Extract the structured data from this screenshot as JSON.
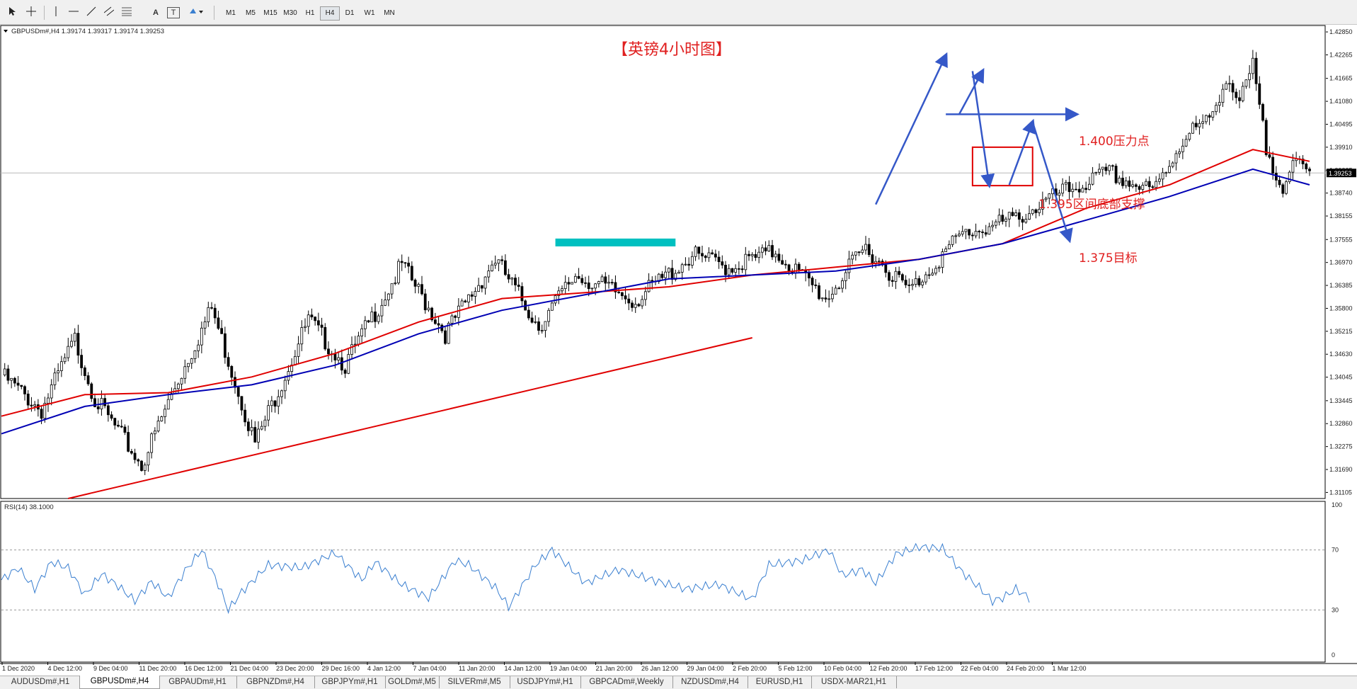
{
  "window": {
    "symbol_header": "GBPUSDm#,H4  1.39174 1.39317 1.39174 1.39253",
    "rsi_header": "RSI(14) 38.1000",
    "current_price_label": "1.39253"
  },
  "toolbar": {
    "tools": [
      "cursor-icon",
      "crosshair-icon",
      "vertical-line-icon",
      "horizontal-line-icon",
      "trendline-icon",
      "channel-icon",
      "fibonacci-icon",
      "text-label-icon",
      "text-box-icon",
      "shapes-icon"
    ],
    "text_tool": "A",
    "textbox_tool": "T",
    "timeframes": [
      "M1",
      "M5",
      "M15",
      "M30",
      "H1",
      "H4",
      "D1",
      "W1",
      "MN"
    ],
    "active_timeframe": "H4"
  },
  "tabs": {
    "items": [
      "AUDUSDm#,H1",
      "GBPUSDm#,H4",
      "GBPAUDm#,H1",
      "GBPNZDm#,H4",
      "GBPJPYm#,H1",
      "GOLDm#,M5",
      "SILVERm#,M5",
      "USDJPYm#,H1",
      "GBPCADm#,Weekly",
      "NZDUSDm#,H4",
      "EURUSD,H1",
      "USDX-MAR21,H1"
    ],
    "active": "GBPUSDm#,H4"
  },
  "chart_data": [
    {
      "type": "candlestick",
      "title": "【英镑4小时图】",
      "ylim": [
        1.3095,
        1.4305
      ],
      "y_ticks": [
        "1.42850",
        "1.42265",
        "1.41665",
        "1.41080",
        "1.40495",
        "1.39910",
        "1.39325",
        "1.38740",
        "1.38155",
        "1.37555",
        "1.36970",
        "1.36385",
        "1.35800",
        "1.35215",
        "1.34630",
        "1.34045",
        "1.33445",
        "1.32860",
        "1.32275",
        "1.31690",
        "1.31105"
      ],
      "x_ticks": [
        "1 Dec 2020",
        "4 Dec 12:00",
        "9 Dec 04:00",
        "11 Dec 20:00",
        "16 Dec 12:00",
        "21 Dec 04:00",
        "23 Dec 20:00",
        "29 Dec 16:00",
        "4 Jan 12:00",
        "7 Jan 04:00",
        "11 Jan 20:00",
        "14 Jan 12:00",
        "19 Jan 04:00",
        "21 Jan 20:00",
        "26 Jan 12:00",
        "29 Jan 04:00",
        "2 Feb 20:00",
        "5 Feb 12:00",
        "10 Feb 04:00",
        "12 Feb 20:00",
        "17 Feb 12:00",
        "22 Feb 04:00",
        "24 Feb 20:00",
        "1 Mar 12:00"
      ],
      "close_path": [
        [
          0,
          1.341
        ],
        [
          12,
          1.332
        ],
        [
          22,
          1.35
        ],
        [
          28,
          1.335
        ],
        [
          42,
          1.318
        ],
        [
          52,
          1.338
        ],
        [
          63,
          1.358
        ],
        [
          76,
          1.3235
        ],
        [
          92,
          1.355
        ],
        [
          103,
          1.3435
        ],
        [
          120,
          1.369
        ],
        [
          133,
          1.3515
        ],
        [
          148,
          1.3705
        ],
        [
          161,
          1.3535
        ],
        [
          172,
          1.3665
        ],
        [
          190,
          1.36
        ],
        [
          207,
          1.3715
        ],
        [
          218,
          1.3685
        ],
        [
          232,
          1.3725
        ],
        [
          247,
          1.3605
        ],
        [
          259,
          1.3735
        ],
        [
          272,
          1.3625
        ],
        [
          288,
          1.377
        ],
        [
          303,
          1.3805
        ],
        [
          318,
          1.3875
        ],
        [
          332,
          1.3925
        ],
        [
          345,
          1.3875
        ],
        [
          355,
          1.4025
        ],
        [
          362,
          1.4055
        ],
        [
          367,
          1.4175
        ],
        [
          371,
          1.41
        ],
        [
          375,
          1.4195
        ],
        [
          379,
          1.3985
        ],
        [
          384,
          1.3895
        ],
        [
          388,
          1.3945
        ],
        [
          392,
          1.3925
        ]
      ],
      "last_price": 1.39253,
      "series": [
        {
          "name": "",
          "color": "#e00000",
          "points": [
            [
              0,
              1.3305
            ],
            [
              25,
              1.336
            ],
            [
              50,
              1.3365
            ],
            [
              75,
              1.3405
            ],
            [
              100,
              1.3465
            ],
            [
              125,
              1.3545
            ],
            [
              150,
              1.3605
            ],
            [
              175,
              1.362
            ],
            [
              200,
              1.3635
            ],
            [
              225,
              1.3665
            ],
            [
              250,
              1.3685
            ],
            [
              275,
              1.3705
            ],
            [
              300,
              1.3745
            ],
            [
              325,
              1.3835
            ],
            [
              350,
              1.3895
            ],
            [
              375,
              1.3985
            ],
            [
              392,
              1.3955
            ]
          ]
        },
        {
          "name": "",
          "color": "#0000b4",
          "points": [
            [
              0,
              1.326
            ],
            [
              25,
              1.333
            ],
            [
              50,
              1.336
            ],
            [
              75,
              1.3385
            ],
            [
              100,
              1.3435
            ],
            [
              125,
              1.3515
            ],
            [
              150,
              1.3575
            ],
            [
              175,
              1.3615
            ],
            [
              200,
              1.3655
            ],
            [
              225,
              1.3665
            ],
            [
              250,
              1.3675
            ],
            [
              275,
              1.3705
            ],
            [
              300,
              1.3745
            ],
            [
              325,
              1.3805
            ],
            [
              350,
              1.3865
            ],
            [
              375,
              1.3935
            ],
            [
              392,
              1.3895
            ]
          ]
        }
      ],
      "annotations": {
        "resistance_label": "1.400压力点",
        "support_label": "1.395区间底部支撑",
        "target_label": "1.375目标",
        "trendline": {
          "color": "#e00000",
          "from": [
            20,
            1.3095
          ],
          "to": [
            225,
            1.3505
          ]
        },
        "resistance_zone": {
          "color": "#00c0c0",
          "x": [
            166,
            202
          ],
          "y": [
            1.3738,
            1.3758
          ]
        },
        "pattern_box": {
          "color": "#e00000",
          "x": [
            291,
            309
          ],
          "y": [
            1.3893,
            1.3991
          ]
        },
        "horizontal_arrow": {
          "x": [
            283,
            322
          ],
          "y": 1.4075
        },
        "up_arrows": [
          [
            [
              262,
              1.3845
            ],
            [
              283,
              1.4225
            ]
          ],
          [
            [
              287,
              1.4075
            ],
            [
              294,
              1.4185
            ]
          ],
          [
            [
              302,
              1.3895
            ],
            [
              309,
              1.4055
            ]
          ]
        ],
        "down_arrows": [
          [
            [
              291,
              1.4185
            ],
            [
              296,
              1.3895
            ]
          ],
          [
            [
              309,
              1.4055
            ],
            [
              320,
              1.3755
            ]
          ]
        ]
      }
    },
    {
      "type": "line",
      "title": "RSI(14) 38.1000",
      "ylim": [
        0,
        100
      ],
      "y_ticks": [
        "100",
        "70",
        "30",
        "0"
      ],
      "levels": [
        70,
        30
      ],
      "color": "#3a7fd0",
      "points": [
        [
          0,
          50
        ],
        [
          5,
          58
        ],
        [
          10,
          44
        ],
        [
          15,
          62
        ],
        [
          20,
          58
        ],
        [
          25,
          40
        ],
        [
          30,
          54
        ],
        [
          35,
          46
        ],
        [
          40,
          36
        ],
        [
          45,
          49
        ],
        [
          50,
          38
        ],
        [
          55,
          56
        ],
        [
          60,
          70
        ],
        [
          65,
          47
        ],
        [
          68,
          30
        ],
        [
          72,
          42
        ],
        [
          80,
          60
        ],
        [
          90,
          58
        ],
        [
          100,
          68
        ],
        [
          108,
          50
        ],
        [
          112,
          62
        ],
        [
          120,
          47
        ],
        [
          128,
          38
        ],
        [
          136,
          63
        ],
        [
          140,
          60
        ],
        [
          148,
          45
        ],
        [
          152,
          32
        ],
        [
          160,
          60
        ],
        [
          165,
          70
        ],
        [
          175,
          48
        ],
        [
          185,
          57
        ],
        [
          195,
          50
        ],
        [
          205,
          44
        ],
        [
          215,
          47
        ],
        [
          225,
          37
        ],
        [
          230,
          60
        ],
        [
          240,
          63
        ],
        [
          248,
          70
        ],
        [
          252,
          53
        ],
        [
          258,
          57
        ],
        [
          262,
          48
        ],
        [
          268,
          67
        ],
        [
          275,
          72
        ],
        [
          282,
          71
        ],
        [
          288,
          55
        ],
        [
          293,
          45
        ],
        [
          297,
          36
        ],
        [
          300,
          38
        ],
        [
          304,
          44
        ],
        [
          308,
          38
        ]
      ]
    }
  ]
}
